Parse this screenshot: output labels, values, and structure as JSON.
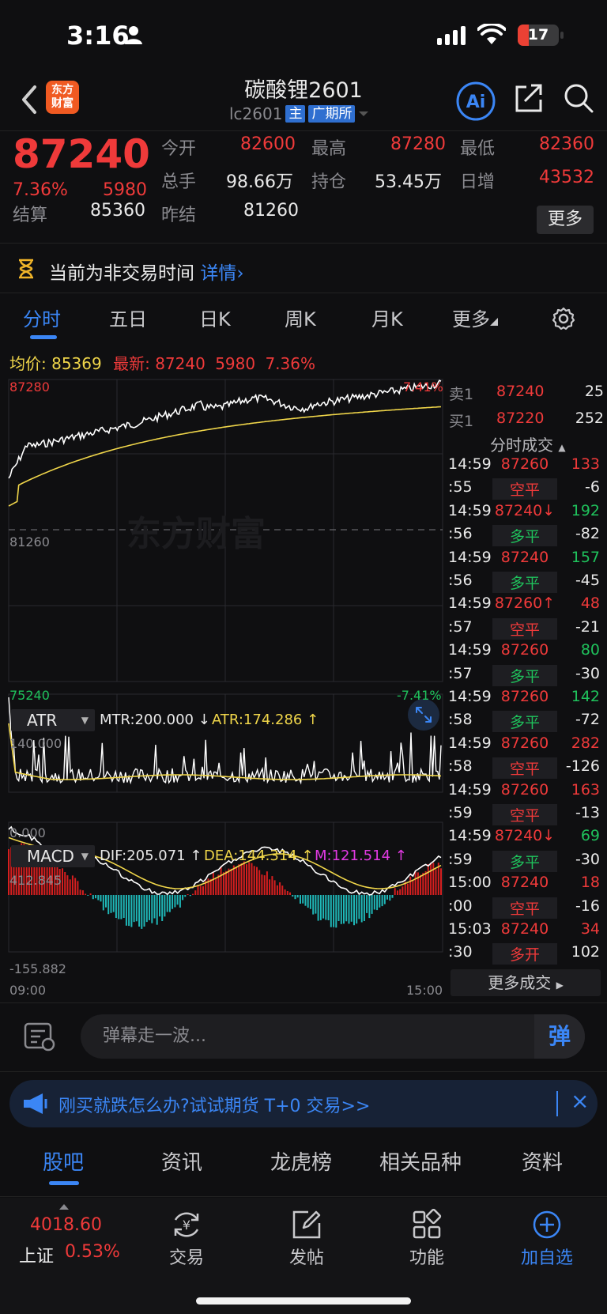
{
  "status": {
    "time": "3:16",
    "battery": "17"
  },
  "nav": {
    "title": "碳酸锂2601",
    "code": "lc2601",
    "tag_main": "主",
    "tag_exchange": "广期所",
    "logo_line1": "东方",
    "logo_line2": "财富"
  },
  "quote": {
    "price": "87240",
    "pct": "7.36%",
    "change": "5980",
    "open_label": "今开",
    "open": "82600",
    "high_label": "最高",
    "high": "87280",
    "low_label": "最低",
    "low": "82360",
    "vol_label": "总手",
    "vol": "98.66万",
    "oi_label": "持仓",
    "oi": "53.45万",
    "daily_label": "日增",
    "daily": "43532",
    "settle_label": "结算",
    "settle": "85360",
    "prev_label": "昨结",
    "prev": "81260",
    "more": "更多"
  },
  "notice": {
    "text": "当前为非交易时间",
    "link": "详情"
  },
  "tabs": [
    "分时",
    "五日",
    "日K",
    "周K",
    "月K",
    "更多"
  ],
  "avg": {
    "avg_label": "均价:",
    "avg": "85369",
    "last_label": "最新:",
    "last": "87240",
    "chg": "5980",
    "pct": "7.36%"
  },
  "chart": {
    "top": "87280",
    "top_pct": "7.41%",
    "mid": "81260",
    "bottom": "75240",
    "bottom_pct": "-7.41%",
    "t_start": "09:00",
    "t_end": "15:00",
    "watermark": "东方财富"
  },
  "atr": {
    "name": "ATR",
    "mtr": "MTR:200.000 ↓",
    "atr": "ATR:174.286 ↑",
    "max": "140.000",
    "min": "0.000"
  },
  "macd": {
    "name": "MACD",
    "dif": "DIF:205.071 ↑",
    "dea": "DEA:144.314 ↑",
    "m": "M:121.514 ↑",
    "max": "412.845",
    "min": "-155.882"
  },
  "orderbook": {
    "ask_label": "卖1",
    "ask": "87240",
    "ask_vol": "25",
    "bid_label": "买1",
    "bid": "87220",
    "bid_vol": "252"
  },
  "trades_head": "分时成交",
  "trades": [
    {
      "t": "14:59",
      "p": "87260",
      "pc": "red",
      "v": "133",
      "vc": "red"
    },
    {
      "t": ":55",
      "p": "空平",
      "pc": "red",
      "v": "-6",
      "vc": "white"
    },
    {
      "t": "14:59",
      "p": "87240↓",
      "pc": "red",
      "v": "192",
      "vc": "green"
    },
    {
      "t": ":56",
      "p": "多平",
      "pc": "green",
      "v": "-82",
      "vc": "white"
    },
    {
      "t": "14:59",
      "p": "87240",
      "pc": "red",
      "v": "157",
      "vc": "green"
    },
    {
      "t": ":56",
      "p": "多平",
      "pc": "green",
      "v": "-45",
      "vc": "white"
    },
    {
      "t": "14:59",
      "p": "87260↑",
      "pc": "red",
      "v": "48",
      "vc": "red"
    },
    {
      "t": ":57",
      "p": "空平",
      "pc": "red",
      "v": "-21",
      "vc": "white"
    },
    {
      "t": "14:59",
      "p": "87260",
      "pc": "red",
      "v": "80",
      "vc": "green"
    },
    {
      "t": ":57",
      "p": "多平",
      "pc": "green",
      "v": "-30",
      "vc": "white"
    },
    {
      "t": "14:59",
      "p": "87260",
      "pc": "red",
      "v": "142",
      "vc": "green"
    },
    {
      "t": ":58",
      "p": "多平",
      "pc": "green",
      "v": "-72",
      "vc": "white"
    },
    {
      "t": "14:59",
      "p": "87260",
      "pc": "red",
      "v": "282",
      "vc": "red"
    },
    {
      "t": ":58",
      "p": "空平",
      "pc": "red",
      "v": "-126",
      "vc": "white"
    },
    {
      "t": "14:59",
      "p": "87260",
      "pc": "red",
      "v": "163",
      "vc": "red"
    },
    {
      "t": ":59",
      "p": "空平",
      "pc": "red",
      "v": "-13",
      "vc": "white"
    },
    {
      "t": "14:59",
      "p": "87240↓",
      "pc": "red",
      "v": "69",
      "vc": "green"
    },
    {
      "t": ":59",
      "p": "多平",
      "pc": "green",
      "v": "-30",
      "vc": "white"
    },
    {
      "t": "15:00",
      "p": "87240",
      "pc": "red",
      "v": "18",
      "vc": "red"
    },
    {
      "t": ":00",
      "p": "空平",
      "pc": "red",
      "v": "-16",
      "vc": "white"
    },
    {
      "t": "15:03",
      "p": "87240",
      "pc": "red",
      "v": "34",
      "vc": "red"
    },
    {
      "t": ":30",
      "p": "多开",
      "pc": "red",
      "v": "102",
      "vc": "white"
    }
  ],
  "more_trades": "更多成交",
  "danmu": {
    "placeholder": "弹幕走一波...",
    "btn": "弹"
  },
  "banner": {
    "text": "刚买就跌怎么办?试试期货 T+0 交易>>",
    "close": "×"
  },
  "lower_tabs": [
    "股吧",
    "资讯",
    "龙虎榜",
    "相关品种",
    "资料"
  ],
  "bottom": {
    "index_value": "4018.60",
    "index_name": "上证",
    "index_pct": "0.53%",
    "items": [
      "交易",
      "发帖",
      "功能",
      "加自选"
    ]
  },
  "colors": {
    "up": "#ef3a3a",
    "down": "#1fc25c",
    "accent": "#3b86f5",
    "avg_line": "#f0d64a",
    "price_line": "#ffffff",
    "macd_bar_neg": "#1fb7b7"
  }
}
